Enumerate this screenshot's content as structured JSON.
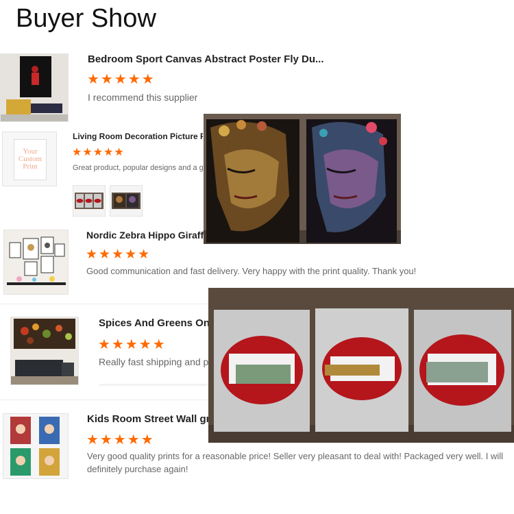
{
  "page_title": "Buyer Show",
  "reviews": [
    {
      "product": "Bedroom Sport Canvas Abstract Poster Fly Du...",
      "stars": "★★★★★",
      "text": "I recommend this supplier"
    },
    {
      "product": "Living Room Decoration Picture P",
      "stars": "★★★★★",
      "text": "Great product, popular designs and a g",
      "thumb_text": "Your Custom Print"
    },
    {
      "product": "Nordic Zebra Hippo Giraffe",
      "stars": "★★★★★",
      "text": "Good communication and fast delivery. Very happy with the print quality. Thank you!"
    },
    {
      "product": "Spices And Greens On",
      "stars": "★★★★★",
      "text": "Really fast shipping and pi"
    },
    {
      "product": "Kids Room Street Wall gra",
      "stars": "★★★★★",
      "text_line1": "Very good quality prints for a reasonable price!  Seller very pleasant to deal with!  Packaged very well.  I will",
      "text_line2": "definitely purchase again!"
    }
  ],
  "colors": {
    "star": "#ff6a00",
    "lips": "#b4161c",
    "canvas_dark": "#1a1410"
  }
}
